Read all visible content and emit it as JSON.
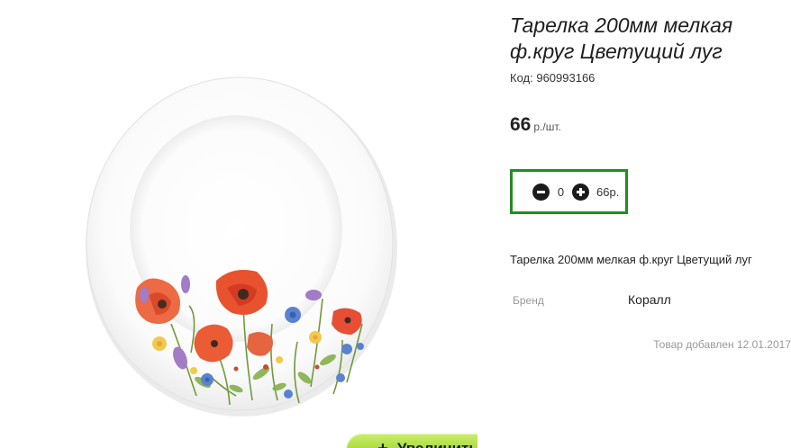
{
  "product": {
    "title": "Тарелка 200мм мелкая ф.круг Цветущий луг",
    "code_label": "Код:",
    "code_value": "960993166",
    "price_value": "66",
    "price_unit": "р./шт.",
    "description": "Тарелка 200мм мелкая ф.круг Цветущий луг",
    "added_text": "Товар добавлен 12.01.2017"
  },
  "quantity": {
    "value": "0",
    "total": "66р."
  },
  "properties": {
    "brand_label": "Бренд",
    "brand_value": "Коралл"
  },
  "image": {
    "zoom_icon": "+",
    "zoom_label": "Увеличить",
    "subject": "white plate with wildflower print"
  },
  "colors": {
    "qty_border": "#1f8f1f",
    "zoom_button_green": "#a9d93c"
  },
  "icons": {
    "minus": "minus-circle-icon",
    "plus": "plus-circle-icon"
  }
}
